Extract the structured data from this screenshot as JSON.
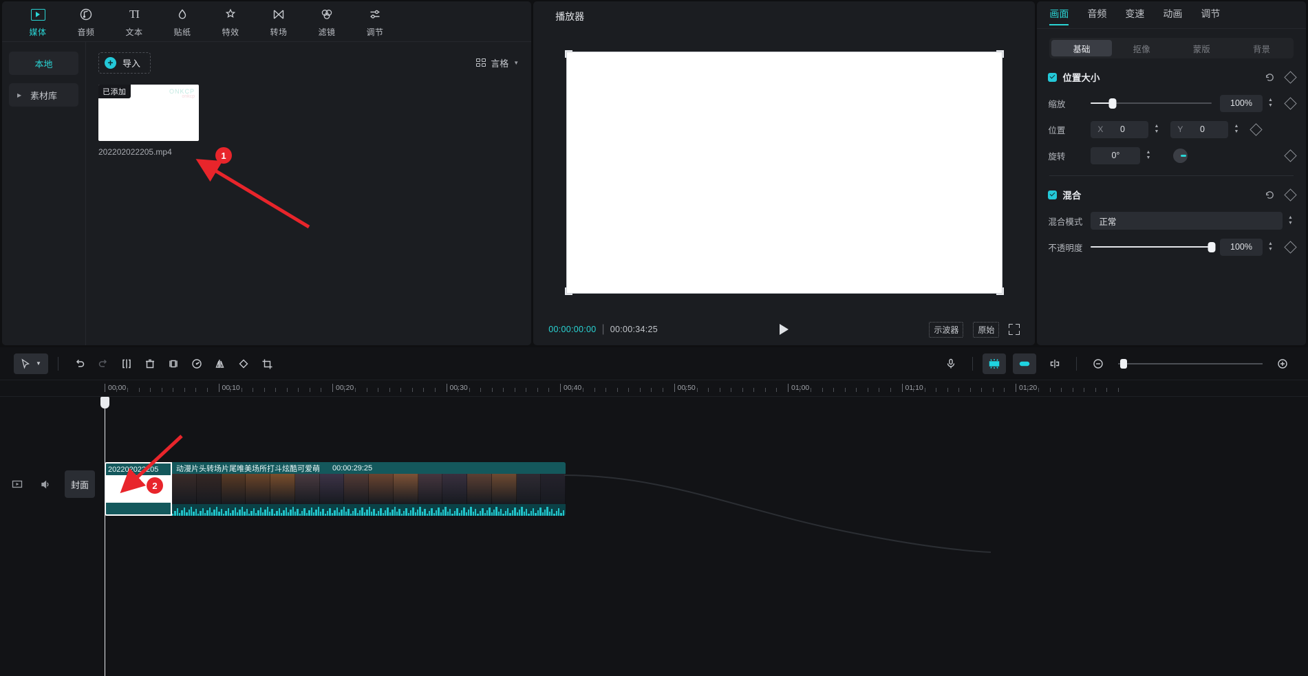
{
  "categories": [
    {
      "label": "媒体",
      "icon": "media-icon",
      "active": true
    },
    {
      "label": "音频",
      "icon": "audio-icon",
      "active": false
    },
    {
      "label": "文本",
      "icon": "text-icon",
      "active": false
    },
    {
      "label": "贴纸",
      "icon": "sticker-icon",
      "active": false
    },
    {
      "label": "特效",
      "icon": "effects-icon",
      "active": false
    },
    {
      "label": "转场",
      "icon": "transition-icon",
      "active": false
    },
    {
      "label": "滤镜",
      "icon": "filter-icon",
      "active": false
    },
    {
      "label": "调节",
      "icon": "adjust-icon",
      "active": false
    }
  ],
  "media": {
    "sidebar": [
      {
        "label": "本地",
        "active": true,
        "expandable": false
      },
      {
        "label": "素材库",
        "active": false,
        "expandable": true
      }
    ],
    "import_label": "导入",
    "view_mode_label": "言格",
    "items": [
      {
        "name": "202202022205.mp4",
        "badge": "已添加",
        "watermark": "ONKCP",
        "watermark_sub": "onkcp"
      }
    ]
  },
  "player": {
    "title": "播放器",
    "current_time": "00:00:00:00",
    "total_time": "00:00:34:25",
    "scope_label": "示波器",
    "original_label": "原始"
  },
  "props": {
    "tabs": [
      {
        "label": "画面",
        "active": true
      },
      {
        "label": "音频",
        "active": false
      },
      {
        "label": "变速",
        "active": false
      },
      {
        "label": "动画",
        "active": false
      },
      {
        "label": "调节",
        "active": false
      }
    ],
    "subtabs": [
      {
        "label": "基础",
        "active": true
      },
      {
        "label": "抠像",
        "active": false
      },
      {
        "label": "蒙版",
        "active": false
      },
      {
        "label": "背景",
        "active": false
      }
    ],
    "position_size": {
      "title": "位置大小",
      "scale_label": "缩放",
      "scale_value": "100%",
      "scale_pct": 18,
      "position_label": "位置",
      "x_axis": "X",
      "x_value": "0",
      "y_axis": "Y",
      "y_value": "0",
      "rotate_label": "旋转",
      "rotate_value": "0°"
    },
    "blend": {
      "title": "混合",
      "mode_label": "混合模式",
      "mode_value": "正常",
      "opacity_label": "不透明度",
      "opacity_value": "100%",
      "opacity_pct": 100
    }
  },
  "timeline": {
    "ruler_labels": [
      "00:00",
      "00:10",
      "00:20",
      "00:30",
      "00:40",
      "00:50",
      "01:00",
      "01:10",
      "01:20"
    ],
    "playhead_time": "00:00",
    "cover_button": "封面",
    "clips": {
      "cover": {
        "name": "202202022205"
      },
      "main": {
        "name": "动漫片头转场片尾唯美场所打斗炫酷可爱萌",
        "duration": "00:00:29:25"
      }
    }
  },
  "annotations": [
    {
      "number": "1"
    },
    {
      "number": "2"
    }
  ],
  "colors": {
    "accent": "#2ad4d4",
    "annotation": "#e8252b",
    "clip": "#14585c"
  }
}
